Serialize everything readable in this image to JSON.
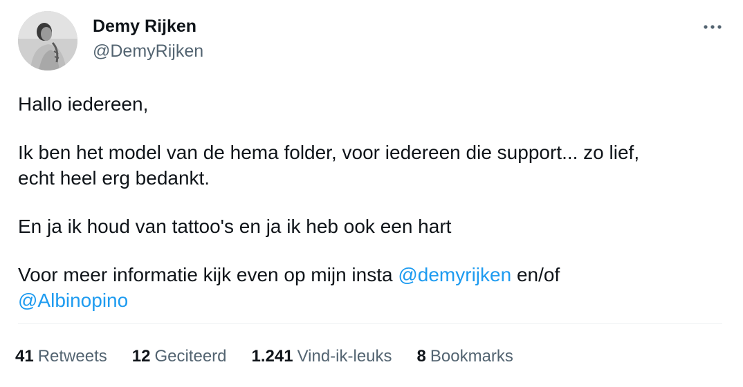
{
  "author": {
    "display_name": "Demy Rijken",
    "handle": "@DemyRijken"
  },
  "tweet": {
    "line1": "Hallo iedereen,",
    "line2a": "Ik ben het model van de hema folder, voor iedereen die support... zo lief,",
    "line2b": "echt heel erg bedankt.",
    "line3": "En ja ik houd van tattoo's en ja ik heb ook een hart",
    "line4_prefix": "Voor meer informatie kijk even op mijn insta ",
    "mention1": "@demyrijken",
    "line4_suffix": " en/of",
    "mention2": "@Albinopino"
  },
  "stats": {
    "retweets": {
      "count": "41",
      "label": "Retweets"
    },
    "quotes": {
      "count": "12",
      "label": "Geciteerd"
    },
    "likes": {
      "count": "1.241",
      "label": "Vind-ik-leuks"
    },
    "bookmarks": {
      "count": "8",
      "label": "Bookmarks"
    }
  },
  "icons": {
    "more": "more-horizontal-icon"
  },
  "colors": {
    "link": "#1d9bf0",
    "secondary_text": "#536471",
    "primary_text": "#0f1419"
  }
}
